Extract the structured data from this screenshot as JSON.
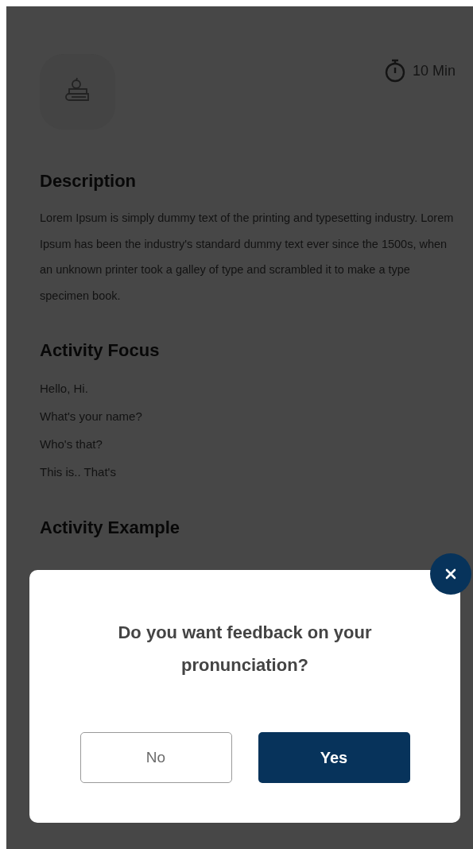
{
  "duration": "10 Min",
  "sections": [
    {
      "title": "Description",
      "kind": "paragraph",
      "text": "Lorem Ipsum is simply dummy text of the printing and typesetting industry. Lorem Ipsum has been the industry's standard dummy text ever since the 1500s, when an unknown printer took a galley of type and scrambled it to make a type specimen book."
    },
    {
      "title": "Activity Focus",
      "kind": "list",
      "items": [
        "Hello, Hi.",
        "What's your name?",
        "Who's that?",
        "This is.. That's"
      ]
    },
    {
      "title": "Activity Example",
      "kind": "heading"
    }
  ],
  "dialog": {
    "question": "Do you want feedback on your pronunciation?",
    "buttons": [
      {
        "label": "No",
        "kind": "secondary"
      },
      {
        "label": "Yes",
        "kind": "primary"
      }
    ]
  }
}
